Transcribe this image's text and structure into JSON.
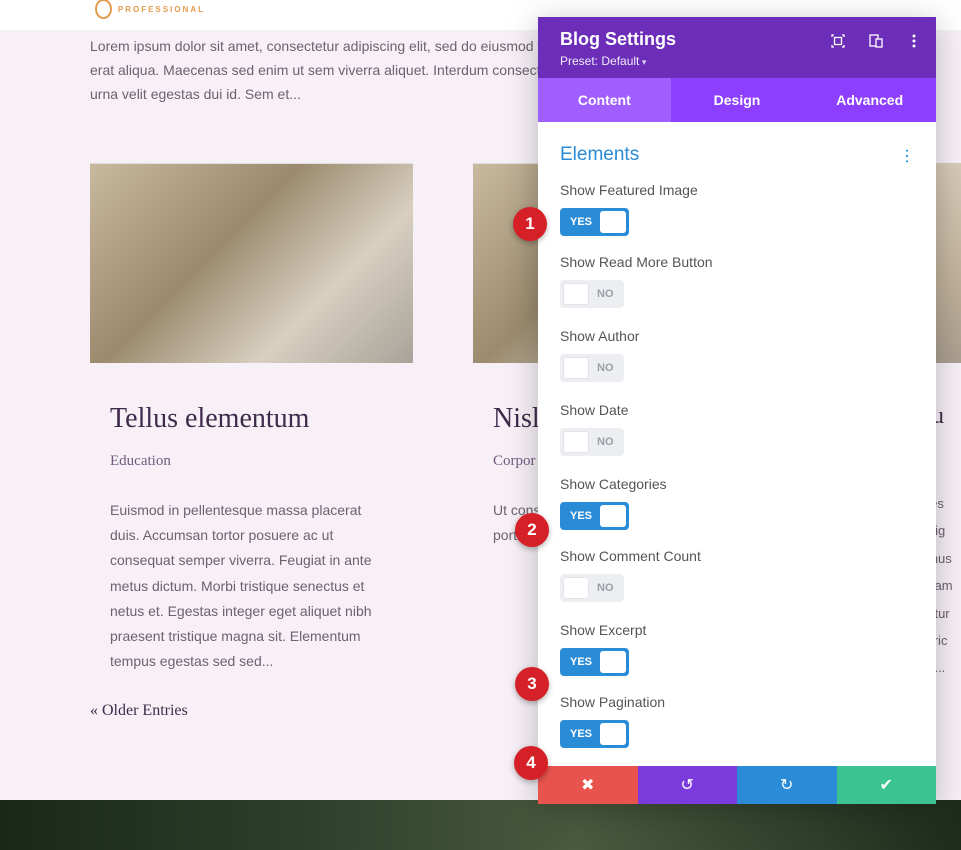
{
  "logo": {
    "text": "PROFESSIONAL"
  },
  "intro": "Lorem ipsum dolor sit amet, consectetur adipiscing elit, sed do eiusmod tempus arcu cursus vitae congue mauris rhoncus erat aliqua. Maecenas sed enim ut sem viverra aliquet. Interdum consectetur libero id faucibus. Arcu libero sit amet. Nisl urna velit egestas dui id. Sem et...",
  "cards": [
    {
      "title": "Tellus elementum",
      "category": "Education",
      "excerpt": "Euismod in pellentesque massa placerat duis. Accumsan tortor posuere ac ut consequat semper viverra. Feugiat in ante metus dictum. Morbi tristique senectus et netus et. Egestas integer eget aliquet nibh praesent tristique magna sit. Elementum tempus egestas sed sed..."
    },
    {
      "title": "Nisl",
      "category": "Corpor",
      "excerpt": "Ut cons laoreet susci Fermen diam vu orci port"
    }
  ],
  "olderEntries": "« Older Entries",
  "rightCol": {
    "titleFrag": "ou",
    "catFrag": "g",
    "lines": [
      "oles",
      "r dig",
      "amus",
      "quam",
      "entur",
      "ultric",
      "on..."
    ]
  },
  "panel": {
    "title": "Blog Settings",
    "preset": "Preset: Default",
    "tabs": {
      "content": "Content",
      "design": "Design",
      "advanced": "Advanced"
    },
    "section": "Elements",
    "options": {
      "featured": {
        "label": "Show Featured Image",
        "on": true
      },
      "readmore": {
        "label": "Show Read More Button",
        "on": false
      },
      "author": {
        "label": "Show Author",
        "on": false
      },
      "date": {
        "label": "Show Date",
        "on": false
      },
      "categories": {
        "label": "Show Categories",
        "on": true
      },
      "comments": {
        "label": "Show Comment Count",
        "on": false
      },
      "excerpt": {
        "label": "Show Excerpt",
        "on": true
      },
      "pagination": {
        "label": "Show Pagination",
        "on": true
      }
    },
    "toggleText": {
      "yes": "YES",
      "no": "NO"
    }
  },
  "markers": {
    "1": "1",
    "2": "2",
    "3": "3",
    "4": "4"
  }
}
